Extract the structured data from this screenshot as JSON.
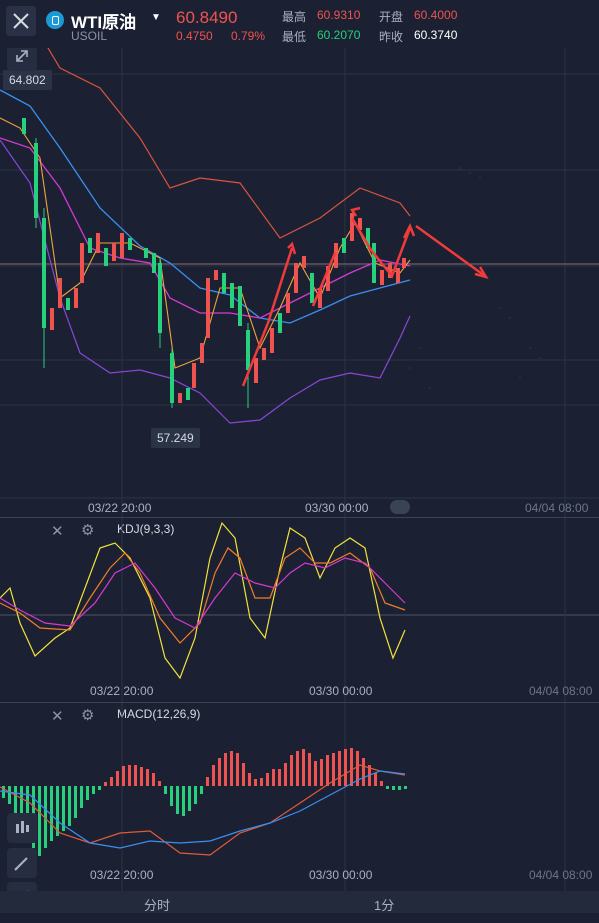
{
  "header": {
    "symbol": "WTI原油",
    "symbol_code": "USOIL",
    "price": "60.8490",
    "change": "0.4750",
    "change_pct": "0.79%",
    "high_label": "最高",
    "high": "60.9310",
    "open_label": "开盘",
    "open": "60.4000",
    "low_label": "最低",
    "low": "60.2070",
    "prev_close_label": "昨收",
    "prev_close": "60.3740",
    "close_icon": "close-icon",
    "caret_icon": "chevron-down-icon"
  },
  "main_chart": {
    "high_marker": "64.802",
    "low_marker": "57.249",
    "time_labels": [
      "03/22 20:00",
      "03/30 00:00",
      "04/04 08:00"
    ]
  },
  "kdj": {
    "label": "KDJ(9,3,3)",
    "time_labels": [
      "03/22 20:00",
      "03/30 00:00",
      "04/04 08:00"
    ]
  },
  "macd": {
    "label": "MACD(12,26,9)",
    "time_labels": [
      "03/22 20:00",
      "03/30 00:00",
      "04/04 08:00"
    ]
  },
  "bottom_tabs": [
    "分时",
    "1分"
  ],
  "colors": {
    "background": "#1b2132",
    "up": "#ef5350",
    "down": "#26d07c",
    "accent_blue": "#1c9ad6"
  }
}
